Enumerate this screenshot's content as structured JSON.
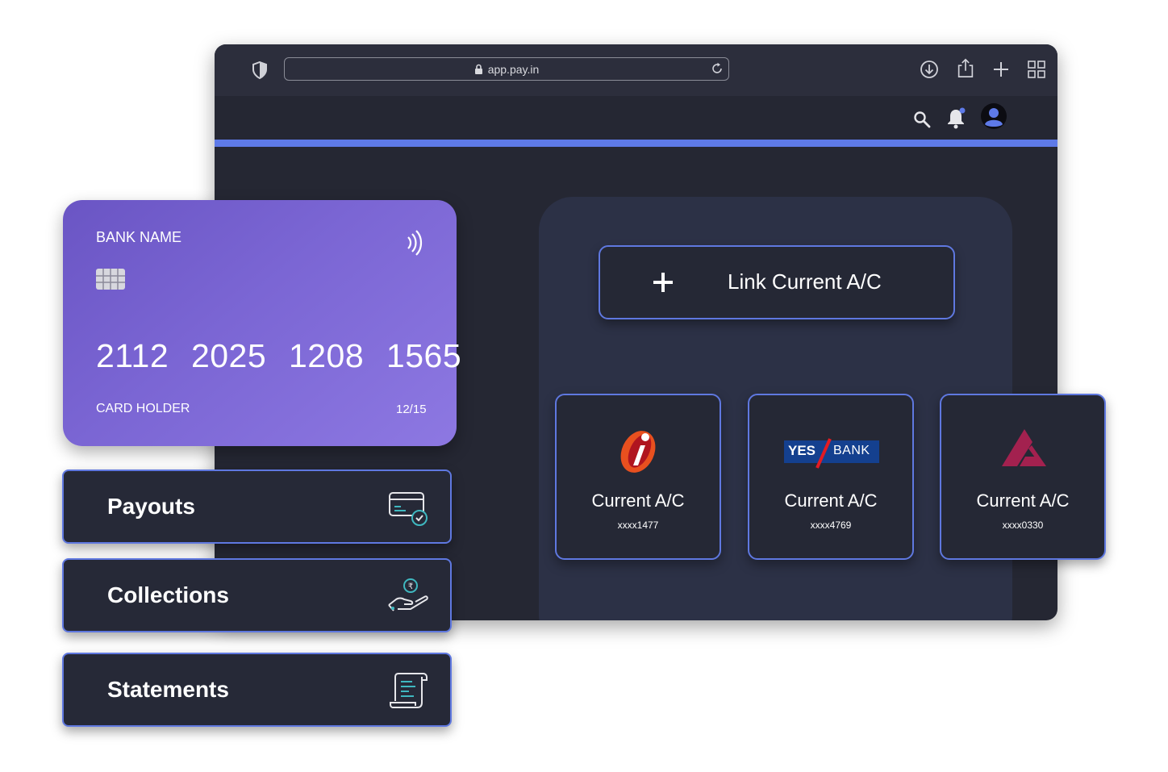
{
  "browser": {
    "url": "app.pay.in",
    "toolbar_icons": [
      "shield-icon",
      "lock-icon",
      "reload-icon",
      "download-icon",
      "share-icon",
      "new-tab-icon",
      "tabs-grid-icon"
    ]
  },
  "app": {
    "header_icons": [
      "search-icon",
      "bell-icon",
      "avatar"
    ],
    "accent_color": "#5e7ae8",
    "link_button": {
      "label": "Link Current A/C"
    },
    "accounts": [
      {
        "bank_logo": "icici-logo",
        "title": "Current A/C",
        "number": "xxxx1477"
      },
      {
        "bank_logo": "yes-bank-logo",
        "logo_text_left": "YES",
        "logo_text_right": "BANK",
        "title": "Current A/C",
        "number": "xxxx4769"
      },
      {
        "bank_logo": "axis-logo",
        "title": "Current A/C",
        "number": "xxxx0330"
      }
    ]
  },
  "credit_card": {
    "bank_name": "BANK NAME",
    "number": "2112  2025  1208  1565",
    "holder": "CARD HOLDER",
    "expiry": "12/15",
    "gradient": [
      "#6a55c4",
      "#8d78e2"
    ]
  },
  "menu": {
    "items": [
      {
        "label": "Payouts",
        "icon": "card-check-icon"
      },
      {
        "label": "Collections",
        "icon": "hand-rupee-icon"
      },
      {
        "label": "Statements",
        "icon": "document-scroll-icon"
      }
    ]
  }
}
